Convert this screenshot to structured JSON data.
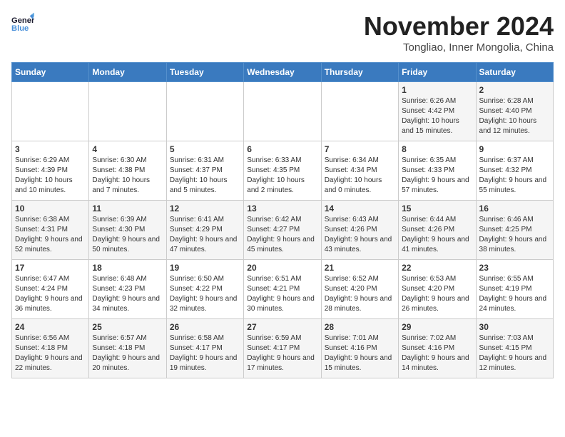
{
  "logo": {
    "line1": "General",
    "line2": "Blue"
  },
  "title": "November 2024",
  "location": "Tongliao, Inner Mongolia, China",
  "days_of_week": [
    "Sunday",
    "Monday",
    "Tuesday",
    "Wednesday",
    "Thursday",
    "Friday",
    "Saturday"
  ],
  "weeks": [
    [
      {
        "day": "",
        "info": ""
      },
      {
        "day": "",
        "info": ""
      },
      {
        "day": "",
        "info": ""
      },
      {
        "day": "",
        "info": ""
      },
      {
        "day": "",
        "info": ""
      },
      {
        "day": "1",
        "info": "Sunrise: 6:26 AM\nSunset: 4:42 PM\nDaylight: 10 hours and 15 minutes."
      },
      {
        "day": "2",
        "info": "Sunrise: 6:28 AM\nSunset: 4:40 PM\nDaylight: 10 hours and 12 minutes."
      }
    ],
    [
      {
        "day": "3",
        "info": "Sunrise: 6:29 AM\nSunset: 4:39 PM\nDaylight: 10 hours and 10 minutes."
      },
      {
        "day": "4",
        "info": "Sunrise: 6:30 AM\nSunset: 4:38 PM\nDaylight: 10 hours and 7 minutes."
      },
      {
        "day": "5",
        "info": "Sunrise: 6:31 AM\nSunset: 4:37 PM\nDaylight: 10 hours and 5 minutes."
      },
      {
        "day": "6",
        "info": "Sunrise: 6:33 AM\nSunset: 4:35 PM\nDaylight: 10 hours and 2 minutes."
      },
      {
        "day": "7",
        "info": "Sunrise: 6:34 AM\nSunset: 4:34 PM\nDaylight: 10 hours and 0 minutes."
      },
      {
        "day": "8",
        "info": "Sunrise: 6:35 AM\nSunset: 4:33 PM\nDaylight: 9 hours and 57 minutes."
      },
      {
        "day": "9",
        "info": "Sunrise: 6:37 AM\nSunset: 4:32 PM\nDaylight: 9 hours and 55 minutes."
      }
    ],
    [
      {
        "day": "10",
        "info": "Sunrise: 6:38 AM\nSunset: 4:31 PM\nDaylight: 9 hours and 52 minutes."
      },
      {
        "day": "11",
        "info": "Sunrise: 6:39 AM\nSunset: 4:30 PM\nDaylight: 9 hours and 50 minutes."
      },
      {
        "day": "12",
        "info": "Sunrise: 6:41 AM\nSunset: 4:29 PM\nDaylight: 9 hours and 47 minutes."
      },
      {
        "day": "13",
        "info": "Sunrise: 6:42 AM\nSunset: 4:27 PM\nDaylight: 9 hours and 45 minutes."
      },
      {
        "day": "14",
        "info": "Sunrise: 6:43 AM\nSunset: 4:26 PM\nDaylight: 9 hours and 43 minutes."
      },
      {
        "day": "15",
        "info": "Sunrise: 6:44 AM\nSunset: 4:26 PM\nDaylight: 9 hours and 41 minutes."
      },
      {
        "day": "16",
        "info": "Sunrise: 6:46 AM\nSunset: 4:25 PM\nDaylight: 9 hours and 38 minutes."
      }
    ],
    [
      {
        "day": "17",
        "info": "Sunrise: 6:47 AM\nSunset: 4:24 PM\nDaylight: 9 hours and 36 minutes."
      },
      {
        "day": "18",
        "info": "Sunrise: 6:48 AM\nSunset: 4:23 PM\nDaylight: 9 hours and 34 minutes."
      },
      {
        "day": "19",
        "info": "Sunrise: 6:50 AM\nSunset: 4:22 PM\nDaylight: 9 hours and 32 minutes."
      },
      {
        "day": "20",
        "info": "Sunrise: 6:51 AM\nSunset: 4:21 PM\nDaylight: 9 hours and 30 minutes."
      },
      {
        "day": "21",
        "info": "Sunrise: 6:52 AM\nSunset: 4:20 PM\nDaylight: 9 hours and 28 minutes."
      },
      {
        "day": "22",
        "info": "Sunrise: 6:53 AM\nSunset: 4:20 PM\nDaylight: 9 hours and 26 minutes."
      },
      {
        "day": "23",
        "info": "Sunrise: 6:55 AM\nSunset: 4:19 PM\nDaylight: 9 hours and 24 minutes."
      }
    ],
    [
      {
        "day": "24",
        "info": "Sunrise: 6:56 AM\nSunset: 4:18 PM\nDaylight: 9 hours and 22 minutes."
      },
      {
        "day": "25",
        "info": "Sunrise: 6:57 AM\nSunset: 4:18 PM\nDaylight: 9 hours and 20 minutes."
      },
      {
        "day": "26",
        "info": "Sunrise: 6:58 AM\nSunset: 4:17 PM\nDaylight: 9 hours and 19 minutes."
      },
      {
        "day": "27",
        "info": "Sunrise: 6:59 AM\nSunset: 4:17 PM\nDaylight: 9 hours and 17 minutes."
      },
      {
        "day": "28",
        "info": "Sunrise: 7:01 AM\nSunset: 4:16 PM\nDaylight: 9 hours and 15 minutes."
      },
      {
        "day": "29",
        "info": "Sunrise: 7:02 AM\nSunset: 4:16 PM\nDaylight: 9 hours and 14 minutes."
      },
      {
        "day": "30",
        "info": "Sunrise: 7:03 AM\nSunset: 4:15 PM\nDaylight: 9 hours and 12 minutes."
      }
    ]
  ]
}
